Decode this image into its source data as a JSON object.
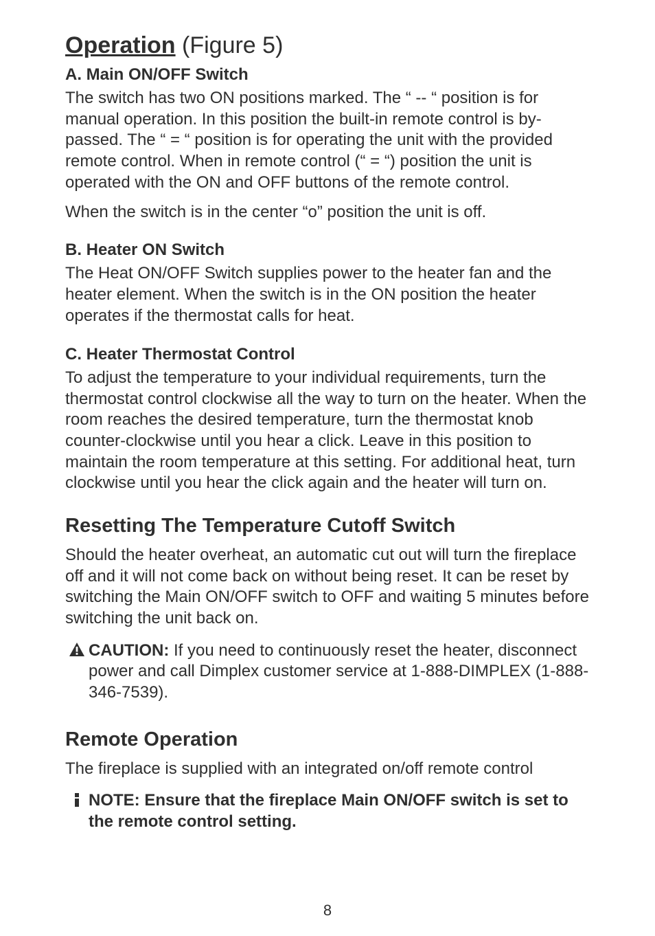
{
  "title": {
    "underlined": "Operation",
    "rest": " (Figure 5)"
  },
  "sectionA": {
    "heading": "A. Main ON/OFF Switch",
    "p1": "The switch has two ON positions marked.  The “ -- “ position is for manual operation.  In this position the built-in remote control is by-passed.  The “ = “ position is for operating the unit with the provided remote control.  When in remote control (“ = “) position the unit is operated with the ON and OFF buttons of the remote control.",
    "p2": "When the switch is in the center “o” position the unit is off."
  },
  "sectionB": {
    "heading": "B. Heater ON Switch",
    "p1": "The Heat ON/OFF Switch supplies power to the heater fan and the heater element.  When the switch is in the ON position the heater operates if the thermostat calls for heat."
  },
  "sectionC": {
    "heading": "C. Heater Thermostat Control",
    "p1": "To adjust the temperature to your individual requirements, turn the thermostat control clockwise all the way to turn on the heater. When the room reaches the desired temperature, turn the thermostat knob counter-clockwise until you hear a click. Leave in this position to maintain the room temperature at this setting. For additional heat, turn clockwise until you hear the click again and the heater will turn on."
  },
  "reset": {
    "heading": "Resetting The Temperature Cutoff Switch",
    "p1": "Should the heater overheat, an automatic cut out will turn the fireplace off and it will not come back on without being reset.  It can be reset by switching the Main ON/OFF switch to OFF and waiting 5 minutes before switching the unit back on."
  },
  "caution": {
    "label": "CAUTION:  ",
    "text": "If you need to continuously reset the heater, disconnect power and call Dimplex customer service at 1-888-DIMPLEX (1-888-346-7539)."
  },
  "remote": {
    "heading": "Remote Operation",
    "p1": "The fireplace is supplied with an integrated on/off remote control"
  },
  "note": {
    "text": "NOTE: Ensure that the fireplace Main ON/OFF switch is set to the remote control setting."
  },
  "page_number": "8",
  "icons": {
    "caution": "caution-icon",
    "note": "note-icon"
  }
}
